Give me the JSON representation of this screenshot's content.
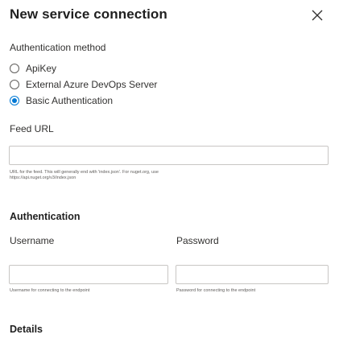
{
  "dialog": {
    "title": "New service connection",
    "close_icon": "close-icon"
  },
  "auth_method": {
    "label": "Authentication method",
    "options": [
      {
        "label": "ApiKey",
        "checked": false
      },
      {
        "label": "External Azure DevOps Server",
        "checked": false
      },
      {
        "label": "Basic Authentication",
        "checked": true
      }
    ]
  },
  "feed_url": {
    "label": "Feed URL",
    "value": "",
    "help_line1": "URL for the feed. This will generally end with 'index.json'. For nuget.org, use",
    "help_line2": "https://api.nuget.org/v3/index.json"
  },
  "authentication": {
    "heading": "Authentication",
    "username": {
      "label": "Username",
      "value": "",
      "help": "Username for connecting to the endpoint"
    },
    "password": {
      "label": "Password",
      "value": "",
      "help": "Password for connecting to the endpoint"
    }
  },
  "details": {
    "heading": "Details"
  },
  "colors": {
    "accent": "#0078d4",
    "border": "#c8c6c4",
    "text": "#323130",
    "help_text": "#605e5c"
  }
}
